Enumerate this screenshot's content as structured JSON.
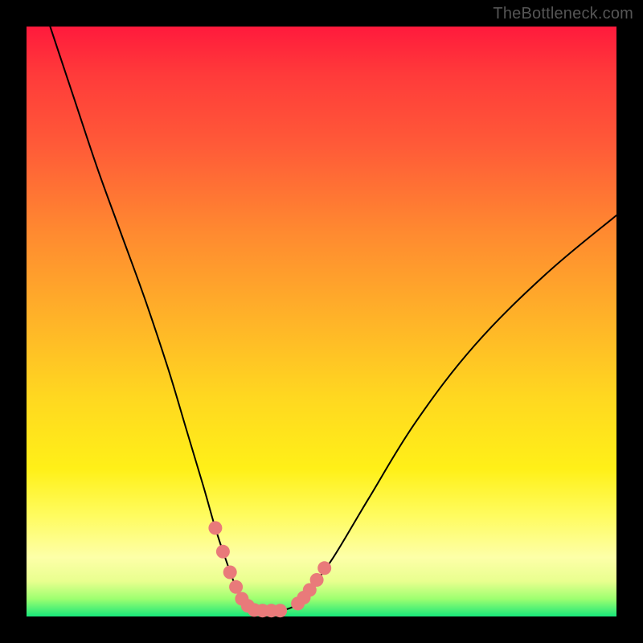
{
  "watermark": "TheBottleneck.com",
  "chart_data": {
    "type": "line",
    "title": "",
    "xlabel": "",
    "ylabel": "",
    "xlim": [
      0,
      100
    ],
    "ylim": [
      0,
      100
    ],
    "series": [
      {
        "name": "curve",
        "x": [
          4,
          8,
          12,
          16,
          20,
          24,
          27,
          30,
          32,
          34,
          35.5,
          37,
          38.5,
          40,
          42,
          44,
          46,
          48,
          52,
          58,
          66,
          76,
          88,
          100
        ],
        "y": [
          100,
          88,
          76,
          65,
          54,
          42,
          32,
          22,
          15,
          9,
          5,
          2.5,
          1.2,
          1,
          1,
          1.2,
          2.2,
          4.5,
          10,
          20,
          33,
          46,
          58,
          68
        ]
      }
    ],
    "markers": [
      {
        "name": "left-cluster",
        "color": "#e97a7a",
        "points": [
          {
            "x": 32.0,
            "y": 15.0
          },
          {
            "x": 33.3,
            "y": 11.0
          },
          {
            "x": 34.5,
            "y": 7.5
          },
          {
            "x": 35.5,
            "y": 5.0
          },
          {
            "x": 36.5,
            "y": 3.0
          },
          {
            "x": 37.5,
            "y": 1.8
          },
          {
            "x": 38.6,
            "y": 1.1
          },
          {
            "x": 40.0,
            "y": 1.0
          },
          {
            "x": 41.5,
            "y": 1.0
          },
          {
            "x": 43.0,
            "y": 1.0
          }
        ]
      },
      {
        "name": "right-cluster",
        "color": "#e97a7a",
        "points": [
          {
            "x": 46.0,
            "y": 2.2
          },
          {
            "x": 47.0,
            "y": 3.2
          },
          {
            "x": 48.0,
            "y": 4.5
          },
          {
            "x": 49.2,
            "y": 6.2
          },
          {
            "x": 50.5,
            "y": 8.2
          }
        ]
      }
    ]
  }
}
